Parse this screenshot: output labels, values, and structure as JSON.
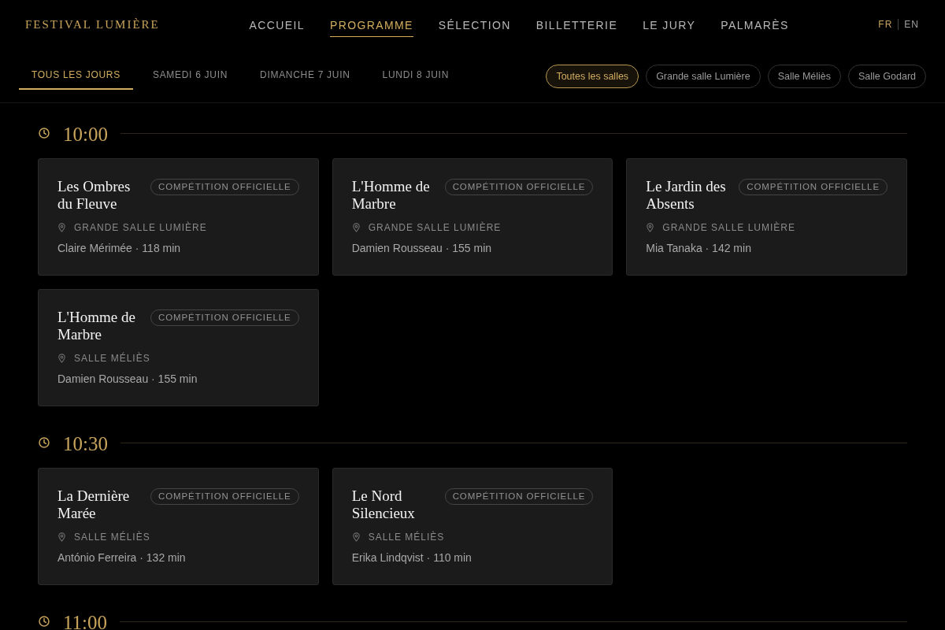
{
  "header": {
    "logo": "FESTIVAL LUMIÈRE",
    "nav": [
      {
        "label": "ACCUEIL",
        "selected": false
      },
      {
        "label": "PROGRAMME",
        "selected": true
      },
      {
        "label": "SÉLECTION",
        "selected": false
      },
      {
        "label": "BILLETTERIE",
        "selected": false
      },
      {
        "label": "LE JURY",
        "selected": false
      },
      {
        "label": "PALMARÈS",
        "selected": false
      }
    ],
    "languages": [
      {
        "label": "FR",
        "selected": true
      },
      {
        "label": "EN",
        "selected": false
      }
    ]
  },
  "day_tabs": [
    {
      "label": "TOUS LES JOURS",
      "selected": true
    },
    {
      "label": "SAMEDI 6 JUIN",
      "selected": false
    },
    {
      "label": "DIMANCHE 7 JUIN",
      "selected": false
    },
    {
      "label": "LUNDI 8 JUIN",
      "selected": false
    }
  ],
  "venue_filters": [
    {
      "label": "Toutes les salles",
      "selected": true
    },
    {
      "label": "Grande salle Lumière",
      "selected": false
    },
    {
      "label": "Salle Méliès",
      "selected": false
    },
    {
      "label": "Salle Godard",
      "selected": false
    }
  ],
  "schedule": [
    {
      "time": "10:00",
      "screenings": [
        {
          "title": "Les Ombres du Fleuve",
          "category": "COMPÉTITION OFFICIELLE",
          "venue": "GRANDE SALLE LUMIÈRE",
          "meta": "Claire Mérimée · 118 min"
        },
        {
          "title": "L'Homme de Marbre",
          "category": "COMPÉTITION OFFICIELLE",
          "venue": "GRANDE SALLE LUMIÈRE",
          "meta": "Damien Rousseau · 155 min"
        },
        {
          "title": "Le Jardin des Absents",
          "category": "COMPÉTITION OFFICIELLE",
          "venue": "GRANDE SALLE LUMIÈRE",
          "meta": "Mia Tanaka · 142 min"
        },
        {
          "title": "L'Homme de Marbre",
          "category": "COMPÉTITION OFFICIELLE",
          "venue": "SALLE MÉLIÈS",
          "meta": "Damien Rousseau · 155 min"
        }
      ]
    },
    {
      "time": "10:30",
      "screenings": [
        {
          "title": "La Dernière Marée",
          "category": "COMPÉTITION OFFICIELLE",
          "venue": "SALLE MÉLIÈS",
          "meta": "António Ferreira · 132 min"
        },
        {
          "title": "Le Nord Silencieux",
          "category": "COMPÉTITION OFFICIELLE",
          "venue": "SALLE MÉLIÈS",
          "meta": "Erika Lindqvist · 110 min"
        }
      ]
    },
    {
      "time": "11:00"
    }
  ]
}
